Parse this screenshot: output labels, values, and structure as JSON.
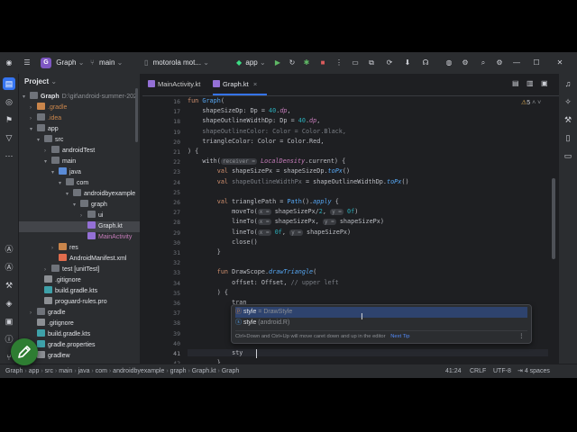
{
  "titlebar": {
    "project_badge": "G",
    "project_name": "Graph",
    "branch": "main",
    "device": "motorola mot...",
    "run_config": "app"
  },
  "project_panel": {
    "title": "Project",
    "items": [
      {
        "label": "Graph",
        "extra": "D:\\git\\android-summer-202",
        "depth": 0,
        "icon": "folder",
        "arrow": "▾"
      },
      {
        "label": ".gradle",
        "depth": 1,
        "icon": "folder-orange",
        "arrow": "›"
      },
      {
        "label": ".idea",
        "depth": 1,
        "icon": "folder",
        "arrow": "›"
      },
      {
        "label": "app",
        "depth": 1,
        "icon": "folder",
        "arrow": "▾"
      },
      {
        "label": "src",
        "depth": 2,
        "icon": "folder",
        "arrow": "▾"
      },
      {
        "label": "androidTest",
        "depth": 3,
        "icon": "folder",
        "arrow": "›"
      },
      {
        "label": "main",
        "depth": 3,
        "icon": "folder",
        "arrow": "▾"
      },
      {
        "label": "java",
        "depth": 4,
        "icon": "folder-src",
        "arrow": "▾"
      },
      {
        "label": "com",
        "depth": 5,
        "icon": "folder",
        "arrow": "▾"
      },
      {
        "label": "androidbyexample",
        "depth": 6,
        "icon": "folder",
        "arrow": "▾"
      },
      {
        "label": "graph",
        "depth": 7,
        "icon": "folder",
        "arrow": "▾"
      },
      {
        "label": "ui",
        "depth": 8,
        "icon": "folder",
        "arrow": "›"
      },
      {
        "label": "Graph.kt",
        "depth": 8,
        "icon": "kt",
        "arrow": "",
        "selected": true
      },
      {
        "label": "MainActivity",
        "depth": 8,
        "icon": "kt",
        "arrow": ""
      },
      {
        "label": "res",
        "depth": 4,
        "icon": "folder-orange",
        "arrow": "›"
      },
      {
        "label": "AndroidManifest.xml",
        "depth": 4,
        "icon": "xml",
        "arrow": ""
      },
      {
        "label": "test [unitTest]",
        "depth": 3,
        "icon": "folder",
        "arrow": "›"
      },
      {
        "label": ".gitignore",
        "depth": 2,
        "icon": "txt",
        "arrow": ""
      },
      {
        "label": "build.gradle.kts",
        "depth": 2,
        "icon": "gradle",
        "arrow": ""
      },
      {
        "label": "proguard-rules.pro",
        "depth": 2,
        "icon": "txt",
        "arrow": ""
      },
      {
        "label": "gradle",
        "depth": 1,
        "icon": "folder",
        "arrow": "›"
      },
      {
        "label": ".gitignore",
        "depth": 1,
        "icon": "txt",
        "arrow": ""
      },
      {
        "label": "build.gradle.kts",
        "depth": 1,
        "icon": "gradle",
        "arrow": ""
      },
      {
        "label": "gradle.properties",
        "depth": 1,
        "icon": "gradle",
        "arrow": ""
      },
      {
        "label": "gradlew",
        "depth": 1,
        "icon": "txt",
        "arrow": ""
      }
    ]
  },
  "tabs": [
    {
      "label": "MainActivity.kt",
      "active": false
    },
    {
      "label": "Graph.kt",
      "active": true,
      "close": "×"
    }
  ],
  "editor": {
    "warnings": "5",
    "line_numbers": [
      "16",
      "17",
      "18",
      "19",
      "20",
      "21",
      "22",
      "23",
      "24",
      "25",
      "26",
      "27",
      "28",
      "29",
      "30",
      "31",
      "32",
      "33",
      "34",
      "35",
      "36",
      "37",
      "38",
      "39",
      "40",
      "41",
      "42"
    ]
  },
  "code": {
    "l16": [
      "fun ",
      "Graph",
      "("
    ],
    "l17": [
      "    shapeSizeDp: Dp = ",
      "40",
      ".",
      "dp",
      ","
    ],
    "l18": [
      "    shapeOutlineWidthDp: Dp = ",
      "40",
      ".",
      "dp",
      ","
    ],
    "l19": [
      "    shapeOutlineColor: Color = Color.Black,"
    ],
    "l20": [
      "    triangleColor: Color = Color.Red,"
    ],
    "l21": [
      ") {"
    ],
    "l22": [
      "    with(",
      "receiver =",
      " ",
      "LocalDensity",
      ".current) {"
    ],
    "l23": [
      "        val ",
      "shapeSizePx",
      " = shapeSizeDp.",
      "toPx",
      "()"
    ],
    "l24": [
      "        val ",
      "shapeOutlineWidthPx",
      " = shapeOutlineWidthDp.",
      "toPx",
      "()"
    ],
    "l26": [
      "        val ",
      "trianglePath",
      " = ",
      "Path",
      "().",
      "apply",
      " {"
    ],
    "l27": [
      "            moveTo(",
      "x =",
      " ",
      "shapeSizePx",
      "/",
      "2",
      ", ",
      "y =",
      " ",
      "0f",
      ")"
    ],
    "l28": [
      "            lineTo(",
      "x =",
      " ",
      "shapeSizePx",
      ", ",
      "y =",
      " ",
      "shapeSizePx",
      ")"
    ],
    "l29": [
      "            lineTo(",
      "x =",
      " ",
      "0f",
      ", ",
      "y =",
      " ",
      "shapeSizePx",
      ")"
    ],
    "l30": [
      "            close()"
    ],
    "l31": [
      "        }"
    ],
    "l33": [
      "        fun ",
      "DrawScope",
      ".",
      "drawTriangle",
      "("
    ],
    "l34": [
      "            offset: Offset, ",
      "// upper left"
    ],
    "l35": [
      "        ) {"
    ],
    "l36": [
      "            tran"
    ],
    "l41": [
      "            sty"
    ],
    "l42": [
      "        }"
    ]
  },
  "completion": {
    "items": [
      {
        "name": "style",
        "detail": " = DrawStyle",
        "selected": true
      },
      {
        "name": "style",
        "detail": " (android.R)",
        "selected": false
      }
    ],
    "hint": "Ctrl+Down and Ctrl+Up will move caret down and up in the editor",
    "next_tip": "Next Tip",
    "more": "⋮"
  },
  "statusbar": {
    "breadcrumbs": [
      "Graph",
      "app",
      "src",
      "main",
      "java",
      "com",
      "androidbyexample",
      "graph",
      "Graph.kt",
      "Graph"
    ],
    "position": "41:24",
    "line_sep": "CRLF",
    "encoding": "UTF-8",
    "indent": "4 spaces"
  },
  "colors": {
    "accent": "#3574f0",
    "background": "#1e1f22",
    "panel": "#2b2d30",
    "keyword": "#cf8e6d",
    "function": "#56a8f5",
    "property": "#c77dbb",
    "number": "#2aacb8",
    "fab": "#2e7d32"
  }
}
